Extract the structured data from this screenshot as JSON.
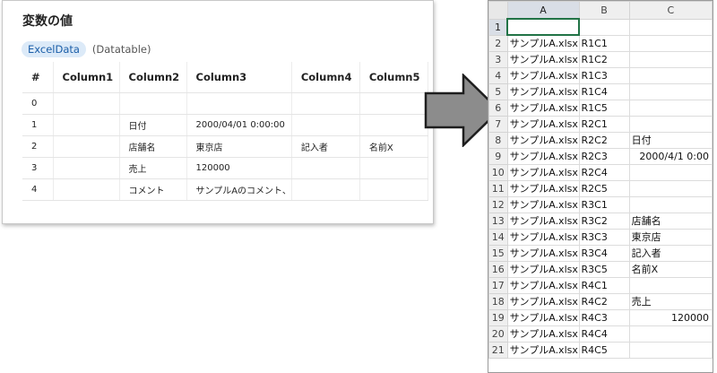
{
  "panel": {
    "title": "変数の値",
    "variable_name": "ExcelData",
    "variable_type": "(Datatable)",
    "columns": [
      "#",
      "Column1",
      "Column2",
      "Column3",
      "Column4",
      "Column5"
    ],
    "rows": [
      [
        "0",
        "",
        "",
        "",
        "",
        ""
      ],
      [
        "1",
        "",
        "日付",
        "2000/04/01 0:00:00",
        "",
        ""
      ],
      [
        "2",
        "",
        "店舗名",
        "東京店",
        "記入者",
        "名前X"
      ],
      [
        "3",
        "",
        "売上",
        "120000",
        "",
        ""
      ],
      [
        "4",
        "",
        "コメント",
        "サンプルAのコメント、",
        "",
        ""
      ]
    ]
  },
  "excel": {
    "columns": [
      "A",
      "B",
      "C"
    ],
    "rows": [
      {
        "n": "1",
        "a": "",
        "b": "",
        "c": ""
      },
      {
        "n": "2",
        "a": "サンプルA.xlsx",
        "b": "R1C1",
        "c": ""
      },
      {
        "n": "3",
        "a": "サンプルA.xlsx",
        "b": "R1C2",
        "c": ""
      },
      {
        "n": "4",
        "a": "サンプルA.xlsx",
        "b": "R1C3",
        "c": ""
      },
      {
        "n": "5",
        "a": "サンプルA.xlsx",
        "b": "R1C4",
        "c": ""
      },
      {
        "n": "6",
        "a": "サンプルA.xlsx",
        "b": "R1C5",
        "c": ""
      },
      {
        "n": "7",
        "a": "サンプルA.xlsx",
        "b": "R2C1",
        "c": ""
      },
      {
        "n": "8",
        "a": "サンプルA.xlsx",
        "b": "R2C2",
        "c": "日付"
      },
      {
        "n": "9",
        "a": "サンプルA.xlsx",
        "b": "R2C3",
        "c": "2000/4/1 0:00",
        "num": true
      },
      {
        "n": "10",
        "a": "サンプルA.xlsx",
        "b": "R2C4",
        "c": ""
      },
      {
        "n": "11",
        "a": "サンプルA.xlsx",
        "b": "R2C5",
        "c": ""
      },
      {
        "n": "12",
        "a": "サンプルA.xlsx",
        "b": "R3C1",
        "c": ""
      },
      {
        "n": "13",
        "a": "サンプルA.xlsx",
        "b": "R3C2",
        "c": "店舗名"
      },
      {
        "n": "14",
        "a": "サンプルA.xlsx",
        "b": "R3C3",
        "c": "東京店"
      },
      {
        "n": "15",
        "a": "サンプルA.xlsx",
        "b": "R3C4",
        "c": "記入者"
      },
      {
        "n": "16",
        "a": "サンプルA.xlsx",
        "b": "R3C5",
        "c": "名前X"
      },
      {
        "n": "17",
        "a": "サンプルA.xlsx",
        "b": "R4C1",
        "c": ""
      },
      {
        "n": "18",
        "a": "サンプルA.xlsx",
        "b": "R4C2",
        "c": "売上"
      },
      {
        "n": "19",
        "a": "サンプルA.xlsx",
        "b": "R4C3",
        "c": "120000",
        "num": true
      },
      {
        "n": "20",
        "a": "サンプルA.xlsx",
        "b": "R4C4",
        "c": ""
      },
      {
        "n": "21",
        "a": "サンプルA.xlsx",
        "b": "R4C5",
        "c": ""
      }
    ]
  },
  "arrow_icon": "right-arrow-icon",
  "colors": {
    "chip_bg": "#dceaf8",
    "chip_text": "#1a5ea8",
    "excel_accent": "#217346",
    "arrow_fill": "#8c8c8c"
  }
}
